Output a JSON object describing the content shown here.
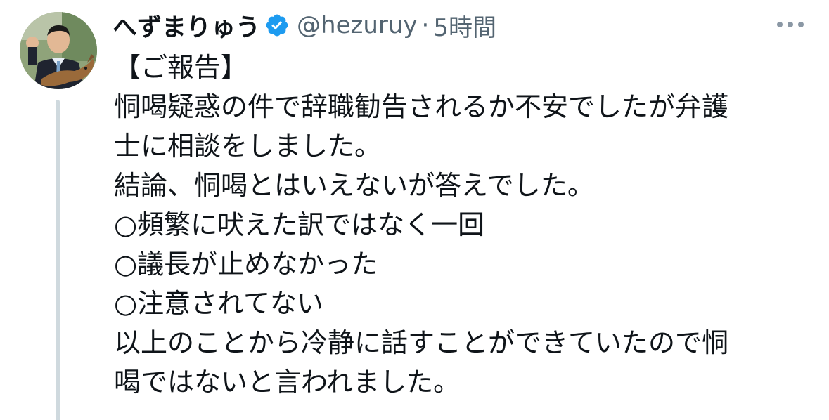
{
  "tweet": {
    "display_name": "へずまりゅう",
    "handle": "@hezuruy",
    "separator": "·",
    "time": "5時間",
    "lines": [
      "【ご報告】",
      "恫喝疑惑の件で辞職勧告されるか不安でしたが弁護",
      "士に相談をしました。",
      "結論、恫喝とはいえないが答えでした。",
      "○頻繁に吠えた訳ではなく一回",
      "○議長が止めなかった",
      "○注意されてない",
      "以上のことから冷静に話すことができていたので恫",
      "喝ではないと言われました。"
    ]
  },
  "icons": {
    "verified": "verified-badge-icon",
    "more": "more-dots-icon"
  },
  "colors": {
    "text": "#0f1419",
    "secondary": "#536471",
    "verified": "#1d9bf0",
    "thread_line": "#cfd9de"
  }
}
